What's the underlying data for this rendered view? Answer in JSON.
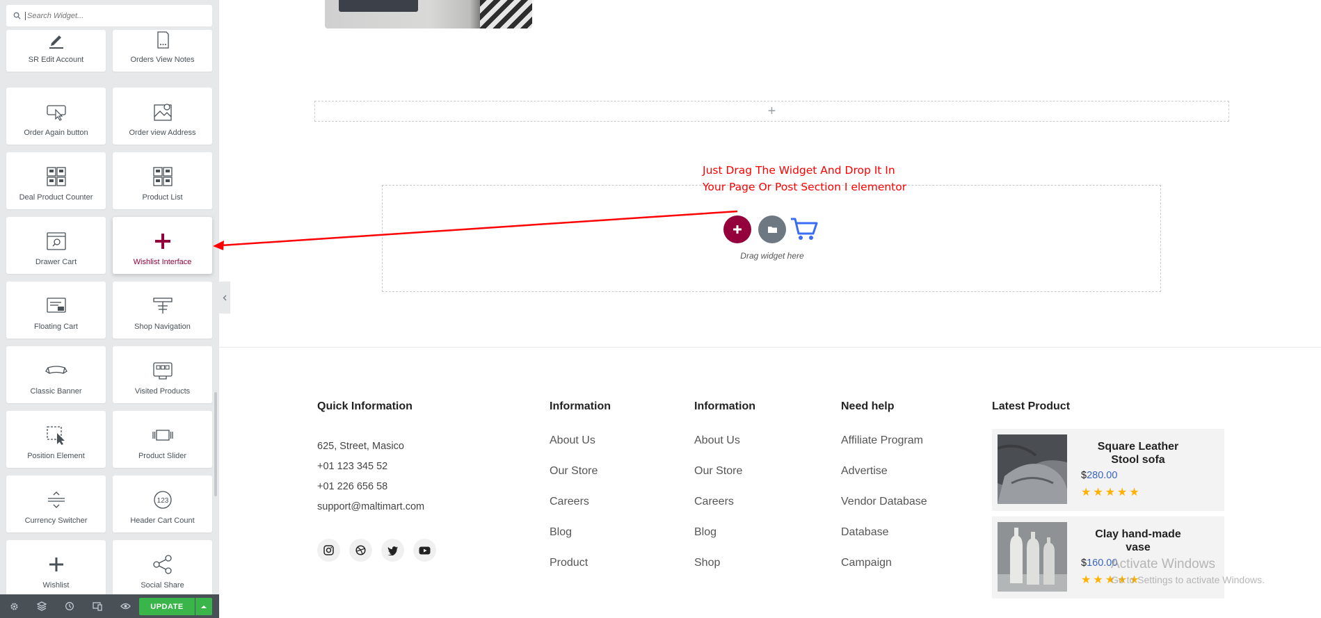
{
  "sidebar": {
    "search_placeholder": "Search Widget...",
    "widgets": [
      {
        "label": "SR Edit Account",
        "icon": "pencil-icon"
      },
      {
        "label": "Orders View Notes",
        "icon": "document-icon"
      },
      {
        "label": "Order Again button",
        "icon": "cursor-box-icon"
      },
      {
        "label": "Order view Address",
        "icon": "map-pin-icon"
      },
      {
        "label": "Deal Product Counter",
        "icon": "grid-products-icon"
      },
      {
        "label": "Product List",
        "icon": "grid-products-icon"
      },
      {
        "label": "Drawer Cart",
        "icon": "window-search-icon"
      },
      {
        "label": "Wishlist Interface",
        "icon": "plus-icon"
      },
      {
        "label": "Floating Cart",
        "icon": "floating-cart-icon"
      },
      {
        "label": "Shop Navigation",
        "icon": "shop-nav-icon"
      },
      {
        "label": "Classic Banner",
        "icon": "banner-icon"
      },
      {
        "label": "Visited Products",
        "icon": "visited-products-icon"
      },
      {
        "label": "Position Element",
        "icon": "position-cursor-icon"
      },
      {
        "label": "Product Slider",
        "icon": "slider-icon"
      },
      {
        "label": "Currency Switcher",
        "icon": "currency-switch-icon"
      },
      {
        "label": "Header Cart Count",
        "icon": "counter-123-icon"
      },
      {
        "label": "Wishlist",
        "icon": "plus-icon"
      },
      {
        "label": "Social Share",
        "icon": "share-icon"
      }
    ],
    "update_label": "UPDATE"
  },
  "canvas": {
    "add_section_symbol": "+",
    "instruction_line1": "Just Drag The Widget And Drop It In",
    "instruction_line2": "Your Page Or Post Section I elementor",
    "drop_text": "Drag widget here"
  },
  "footer": {
    "quick_info": {
      "title": "Quick Information",
      "address": "625, Street, Masico",
      "phone1": "+01 123 345 52",
      "phone2": "+01 226 656 58",
      "email": "support@maltimart.com"
    },
    "info1": {
      "title": "Information",
      "links": [
        "About Us",
        "Our Store",
        "Careers",
        "Blog",
        "Product"
      ]
    },
    "info2": {
      "title": "Information",
      "links": [
        "About Us",
        "Our Store",
        "Careers",
        "Blog",
        "Shop"
      ]
    },
    "help": {
      "title": "Need help",
      "links": [
        "Affiliate Program",
        "Advertise",
        "Vendor Database",
        "Database",
        "Campaign"
      ]
    },
    "latest": {
      "title": "Latest Product",
      "products": [
        {
          "title": "Square Leather Stool sofa",
          "currency": "$",
          "price": "280.00",
          "rating": 5
        },
        {
          "title": "Clay hand-made vase",
          "currency": "$",
          "price": "160.00",
          "rating": 5
        }
      ]
    }
  },
  "watermark": {
    "line1": "Activate Windows",
    "line2": "Go to Settings to activate Windows."
  },
  "colors": {
    "accent": "#93003c",
    "update_green": "#39b54a",
    "annotation_red": "#ff0000",
    "price_blue": "#3a63c7",
    "star": "#ffb100"
  }
}
